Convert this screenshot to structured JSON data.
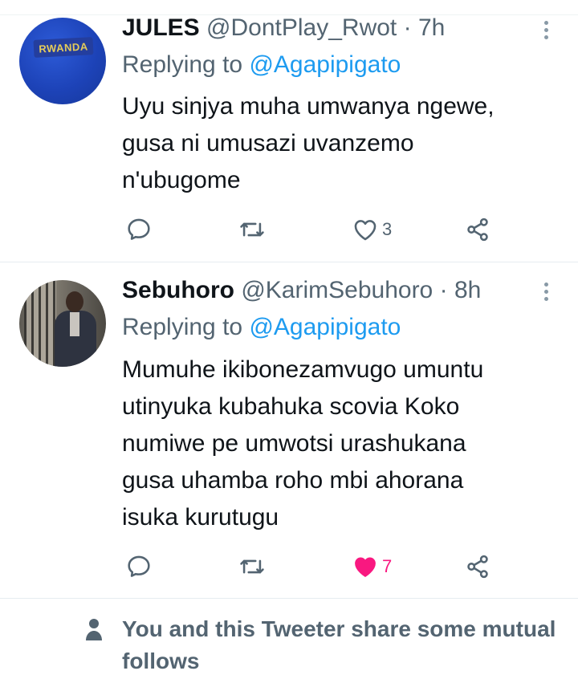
{
  "tweets": [
    {
      "display_name": "JULES",
      "handle": "@DontPlay_Rwot",
      "dot": "·",
      "time": "7h",
      "replying_label": "Replying to",
      "replying_handle": "@Agapipigato",
      "avatar_text": "RWANDA",
      "lines": [
        "Uyu sinjya muha umwanya ngewe,",
        "gusa ni umusazi uvanzemo",
        "n'ubugome"
      ],
      "like_count": "3",
      "liked": false
    },
    {
      "display_name": "Sebuhoro",
      "handle": "@KarimSebuhoro",
      "dot": "·",
      "time": "8h",
      "replying_label": "Replying to",
      "replying_handle": "@Agapipigato",
      "lines": [
        "Mumuhe ikibonezamvugo umuntu",
        "utinyuka kubahuka scovia Koko",
        "numiwe pe umwotsi urashukana",
        "gusa uhamba roho mbi ahorana",
        "isuka kurutugu"
      ],
      "like_count": "7",
      "liked": true
    }
  ],
  "mutual": {
    "text": "You and this Tweeter share some mutual follows",
    "icon": "person-icon"
  },
  "colors": {
    "accent": "#1d9bf0",
    "secondary": "#536471",
    "like": "#f91880",
    "separator": "#e6ecf0"
  }
}
